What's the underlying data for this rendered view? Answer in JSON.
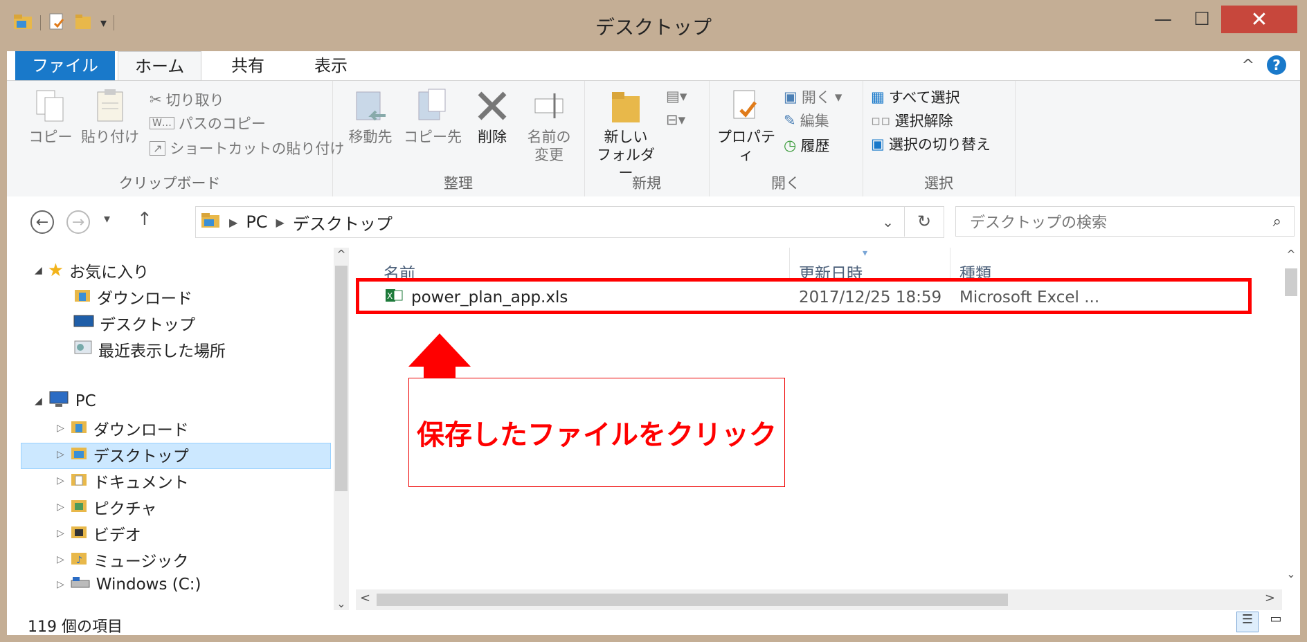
{
  "window": {
    "title": "デスクトップ"
  },
  "tabs": [
    {
      "label": "ファイル"
    },
    {
      "label": "ホーム"
    },
    {
      "label": "共有"
    },
    {
      "label": "表示"
    }
  ],
  "ribbon": {
    "clipboard": {
      "group_label": "クリップボード",
      "copy": "コピー",
      "paste": "貼り付け",
      "cut": "切り取り",
      "copy_path": "パスのコピー",
      "paste_shortcut": "ショートカットの貼り付け"
    },
    "organize": {
      "group_label": "整理",
      "move_to": "移動先",
      "copy_to": "コピー先",
      "delete": "削除",
      "rename_line1": "名前の",
      "rename_line2": "変更"
    },
    "new": {
      "group_label": "新規",
      "new_folder_line1": "新しい",
      "new_folder_line2": "フォルダー"
    },
    "open": {
      "group_label": "開く",
      "properties": "プロパティ",
      "open": "開く",
      "edit": "編集",
      "history": "履歴"
    },
    "select": {
      "group_label": "選択",
      "select_all": "すべて選択",
      "select_none": "選択解除",
      "invert": "選択の切り替え"
    }
  },
  "address": {
    "crumbs": [
      "PC",
      "デスクトップ"
    ],
    "search_placeholder": "デスクトップの検索"
  },
  "nav": {
    "favorites": "お気に入り",
    "fav_items": [
      "ダウンロード",
      "デスクトップ",
      "最近表示した場所"
    ],
    "pc": "PC",
    "pc_items": [
      "ダウンロード",
      "デスクトップ",
      "ドキュメント",
      "ピクチャ",
      "ビデオ",
      "ミュージック",
      "Windows (C:)"
    ]
  },
  "columns": {
    "name": "名前",
    "date": "更新日時",
    "type": "種類"
  },
  "files": [
    {
      "name": "power_plan_app.xls",
      "date": "2017/12/25 18:59",
      "type": "Microsoft Excel ..."
    }
  ],
  "annotation": {
    "text": "保存したファイルをクリック"
  },
  "status": {
    "count": "119 個の項目"
  },
  "colors": {
    "accent": "#1979ca",
    "frame": "#c4ae95",
    "highlight": "#ff0000",
    "close": "#c7473c"
  }
}
